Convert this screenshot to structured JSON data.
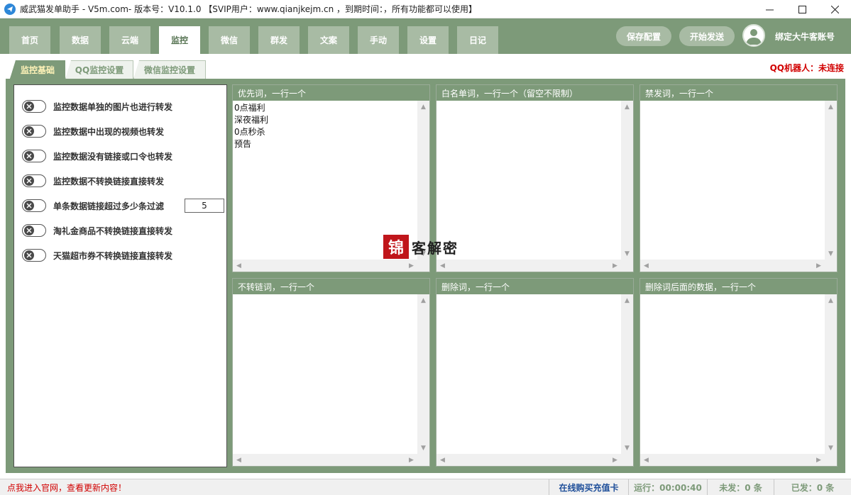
{
  "window": {
    "title": "威武猫发单助手 - V5m.com- 版本号：V10.1.0      【SVIP用户：www.qianjkejm.cn ，到期时间：，所有功能都可以使用】"
  },
  "nav": {
    "tabs": [
      {
        "label": "首页"
      },
      {
        "label": "数据"
      },
      {
        "label": "云端"
      },
      {
        "label": "监控"
      },
      {
        "label": "微信"
      },
      {
        "label": "群发"
      },
      {
        "label": "文案"
      },
      {
        "label": "手动"
      },
      {
        "label": "设置"
      },
      {
        "label": "日记"
      }
    ],
    "active_tab": "监控",
    "save_label": "保存配置",
    "start_label": "开始发送",
    "bind_label": "绑定大牛客账号"
  },
  "subtabs": {
    "items": [
      {
        "label": "监控基础"
      },
      {
        "label": "QQ监控设置"
      },
      {
        "label": "微信监控设置"
      }
    ],
    "active": "监控基础",
    "qq_robot_status": "QQ机器人：未连接"
  },
  "options": [
    {
      "label": "监控数据单独的图片也进行转发",
      "enabled": false
    },
    {
      "label": "监控数据中出现的视频也转发",
      "enabled": false
    },
    {
      "label": "监控数据没有链接或口令也转发",
      "enabled": false
    },
    {
      "label": "监控数据不转换链接直接转发",
      "enabled": false
    },
    {
      "label": "单条数据链接超过多少条过滤",
      "enabled": false,
      "value": "5"
    },
    {
      "label": "淘礼金商品不转换链接直接转发",
      "enabled": false
    },
    {
      "label": "天猫超市券不转换链接直接转发",
      "enabled": false
    }
  ],
  "panels": [
    {
      "header": "优先词，一行一个",
      "content": "0点福利\n深夜福利\n0点秒杀\n预告"
    },
    {
      "header": "白名单词，一行一个（留空不限制）",
      "content": ""
    },
    {
      "header": "禁发词，一行一个",
      "content": ""
    },
    {
      "header": "不转链词，一行一个",
      "content": ""
    },
    {
      "header": "删除词，一行一个",
      "content": ""
    },
    {
      "header": "删除词后面的数据，一行一个",
      "content": ""
    }
  ],
  "watermark": {
    "mark": "锦",
    "text": "客解密"
  },
  "status": {
    "link": "点我进入官网，查看更新内容！",
    "buy": "在线购买充值卡",
    "running": "运行：00:00:40",
    "unsent": "未发：0 条",
    "sent": "已发：0 条"
  },
  "colors": {
    "nav_bg": "#7d9a79",
    "tab_bg": "#a8bba4",
    "alert": "#d10000"
  }
}
